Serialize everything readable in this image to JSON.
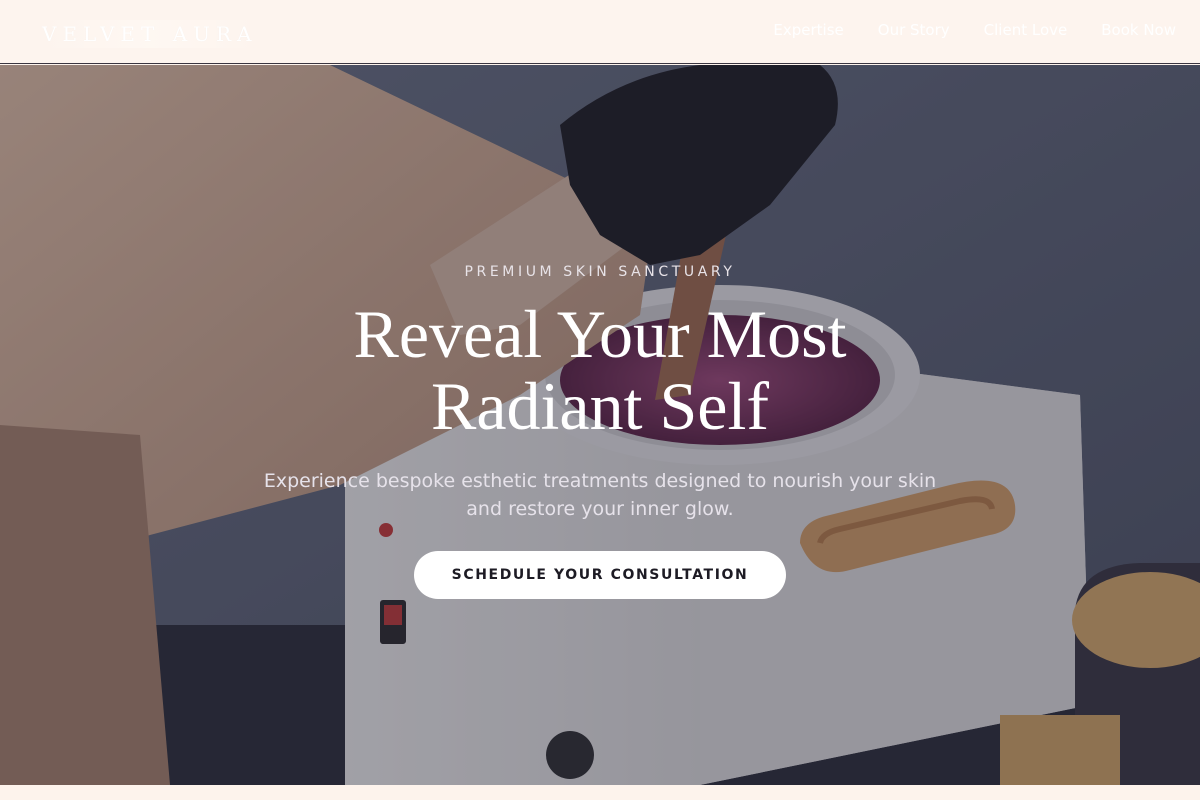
{
  "brand": {
    "logo_text": "VELVET AURA"
  },
  "nav": {
    "links": [
      {
        "label": "Expertise"
      },
      {
        "label": "Our Story"
      },
      {
        "label": "Client Love"
      },
      {
        "label": "Book Now"
      }
    ]
  },
  "hero": {
    "eyebrow": "PREMIUM SKIN SANCTUARY",
    "headline_line1": "Reveal Your Most",
    "headline_line2": "Radiant Self",
    "subtitle": "Experience bespoke esthetic treatments designed to nourish your skin and restore your inner glow.",
    "cta_label": "SCHEDULE YOUR CONSULTATION",
    "image_alt": "Wax warmer being used with a gloved hand"
  },
  "colors": {
    "background": "#fdf3ec",
    "overlay": "rgba(30,28,45,0.38)",
    "cta_background": "#ffffff",
    "cta_text": "#1d1b24"
  }
}
